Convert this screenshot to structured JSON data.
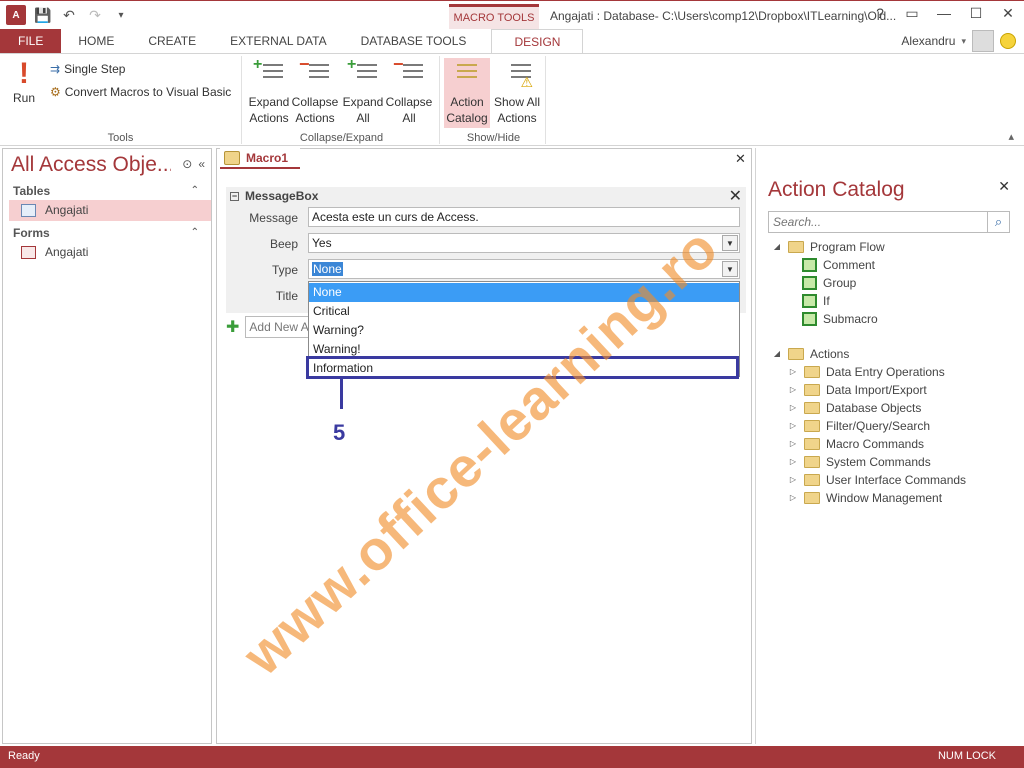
{
  "titlebar": {
    "app_logo": "A",
    "undo": "↶",
    "redo": "↷",
    "save": "💾",
    "context_tab": "MACRO TOOLS",
    "window_title": "Angajati : Database- C:\\Users\\comp12\\Dropbox\\ITLearning\\Old...",
    "help": "?",
    "restore": "▭",
    "minimize": "—",
    "maximize": "☐",
    "close": "✕"
  },
  "ribbon_tabs": [
    "FILE",
    "HOME",
    "CREATE",
    "EXTERNAL DATA",
    "DATABASE TOOLS",
    "DESIGN"
  ],
  "user": {
    "name": "Alexandru"
  },
  "ribbon": {
    "tools": {
      "label": "Tools",
      "run": "Run",
      "single_step": "Single Step",
      "convert": "Convert Macros to Visual Basic"
    },
    "collapse_expand": {
      "label": "Collapse/Expand",
      "expand_actions": [
        "Expand",
        "Actions"
      ],
      "collapse_actions": [
        "Collapse",
        "Actions"
      ],
      "expand_all": [
        "Expand",
        "All"
      ],
      "collapse_all": [
        "Collapse",
        "All"
      ]
    },
    "show_hide": {
      "label": "Show/Hide",
      "action_catalog": [
        "Action",
        "Catalog"
      ],
      "show_all_actions": [
        "Show All",
        "Actions"
      ]
    }
  },
  "navpane": {
    "title": "All Access Obje...",
    "sections": [
      {
        "name": "Tables",
        "items": [
          "Angajati"
        ]
      },
      {
        "name": "Forms",
        "items": [
          "Angajati"
        ]
      }
    ]
  },
  "document": {
    "tab": "Macro1",
    "action": "MessageBox",
    "args": {
      "message_label": "Message",
      "message_value": "Acesta este un curs de Access.",
      "beep_label": "Beep",
      "beep_value": "Yes",
      "type_label": "Type",
      "type_value": "None",
      "title_label": "Title"
    },
    "add_action_placeholder": "Add New A",
    "dropdown_options": [
      "None",
      "Critical",
      "Warning?",
      "Warning!",
      "Information"
    ],
    "selected_option": "None",
    "callout_number": "5"
  },
  "catalog": {
    "title": "Action Catalog",
    "search_placeholder": "Search...",
    "program_flow": {
      "label": "Program Flow",
      "items": [
        "Comment",
        "Group",
        "If",
        "Submacro"
      ]
    },
    "actions": {
      "label": "Actions",
      "items": [
        "Data Entry Operations",
        "Data Import/Export",
        "Database Objects",
        "Filter/Query/Search",
        "Macro Commands",
        "System Commands",
        "User Interface Commands",
        "Window Management"
      ]
    }
  },
  "watermark": "www.office-learning.ro",
  "statusbar": {
    "left": "Ready",
    "right": "NUM LOCK"
  },
  "colors": {
    "accent": "#a4373a",
    "selection": "#3b9cf5",
    "callout": "#3a3aa0",
    "watermark": "#f08c28"
  }
}
